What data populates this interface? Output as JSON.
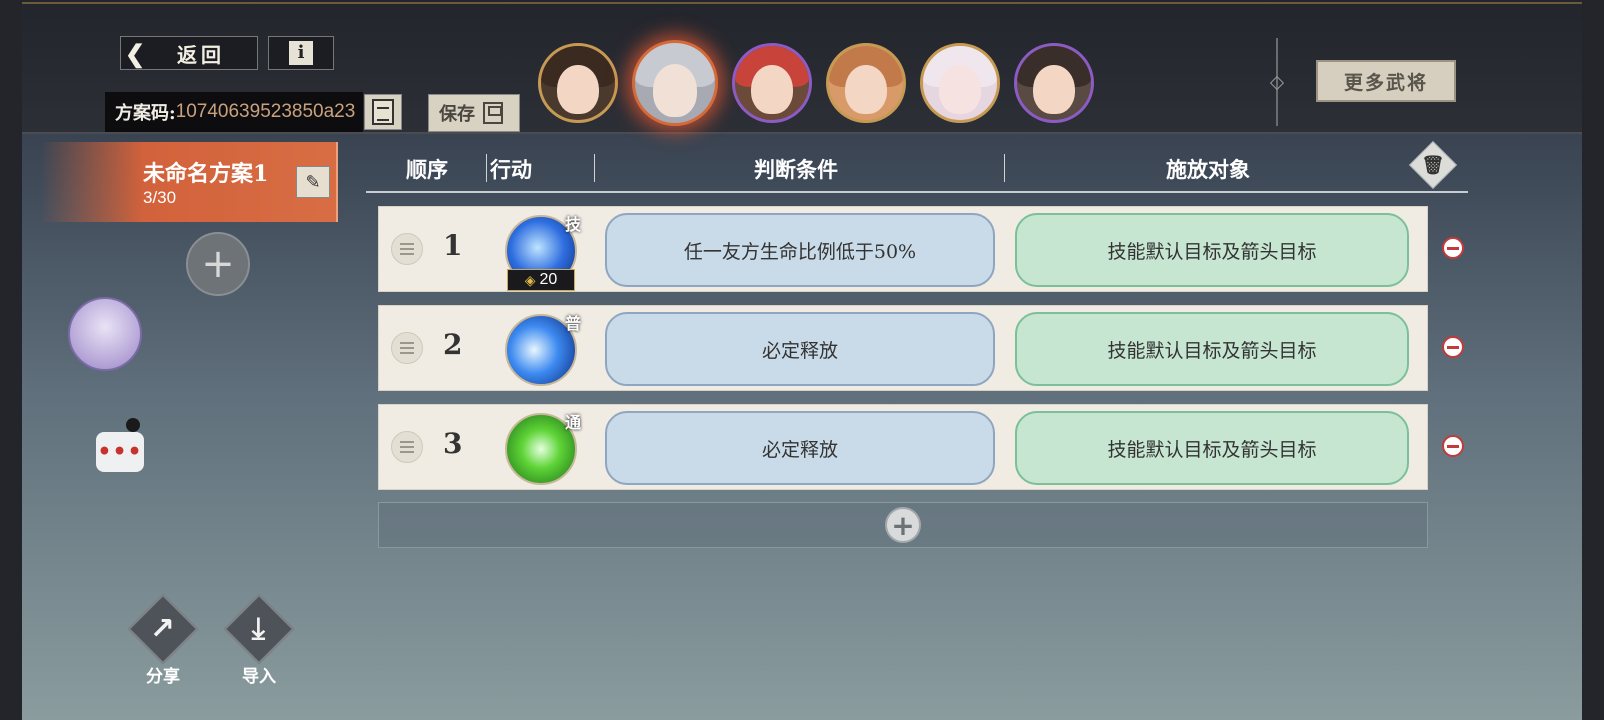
{
  "header": {
    "back_label": "返回",
    "info_icon": "i",
    "plan_code_label": "方案码:",
    "plan_code_value": "10740639523850a23",
    "save_label": "保存",
    "more_generals_label": "更多武将"
  },
  "portraits": [
    {
      "name": "portrait-1",
      "selected": false
    },
    {
      "name": "portrait-2",
      "selected": true
    },
    {
      "name": "portrait-3",
      "selected": false
    },
    {
      "name": "portrait-4",
      "selected": false
    },
    {
      "name": "portrait-5",
      "selected": false
    },
    {
      "name": "portrait-6",
      "selected": false
    }
  ],
  "plan": {
    "name": "未命名方案1",
    "count": "3/30"
  },
  "table": {
    "headers": {
      "order": "顺序",
      "action": "行动",
      "condition": "判断条件",
      "target": "施放对象"
    },
    "rows": [
      {
        "order": "1",
        "skill_tag": "技",
        "cost": "20",
        "condition": "任一友方生命比例低于50%",
        "target": "技能默认目标及箭头目标"
      },
      {
        "order": "2",
        "skill_tag": "普",
        "condition": "必定释放",
        "target": "技能默认目标及箭头目标"
      },
      {
        "order": "3",
        "skill_tag": "通",
        "condition": "必定释放",
        "target": "技能默认目标及箭头目标"
      }
    ]
  },
  "bottom_actions": {
    "share_label": "分享",
    "import_label": "导入"
  },
  "colors": {
    "accent_orange": "#d2623b",
    "condition_blue": "#c9dbe8",
    "target_green": "#c7e6d2",
    "remove_red": "#c23a3a"
  },
  "icons": {
    "back": "chevron-left-icon",
    "copy": "copy-doc-icon",
    "save": "floppy-icon",
    "edit": "pencil-icon",
    "trash": "trash-icon",
    "share": "share-icon",
    "import": "import-icon",
    "chat": "chat-icon"
  }
}
